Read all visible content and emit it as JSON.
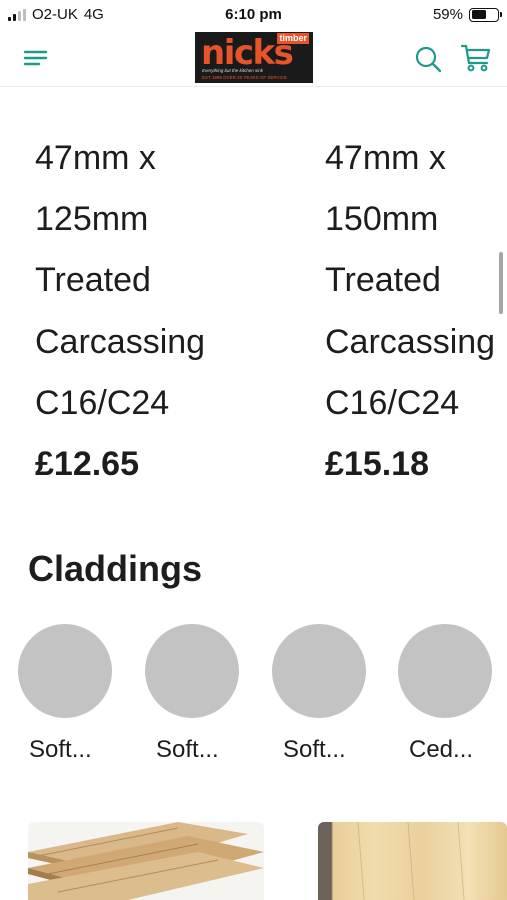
{
  "status_bar": {
    "carrier": "O2-UK",
    "network": "4G",
    "time": "6:10 pm",
    "battery_percent": "59%",
    "battery_level": 0.59
  },
  "header": {
    "logo_text": "nicks",
    "logo_sub": "timber",
    "logo_tagline": "Everything but the kitchen sink",
    "logo_est": "EST 1999 OVER 20 YEARS OF SERVICE",
    "icons": [
      "menu-icon",
      "search-icon",
      "cart-icon"
    ],
    "accent_color": "#1f9a8a",
    "logo_color": "#e8542a"
  },
  "products": [
    {
      "lines": [
        "47mm x",
        "125mm",
        "Treated",
        "Carcassing",
        "C16/C24"
      ],
      "price": "£12.65"
    },
    {
      "lines": [
        "47mm x",
        "150mm",
        "Treated",
        "Carcassing",
        "C16/C24"
      ],
      "price": "£15.18"
    }
  ],
  "claddings": {
    "title": "Claddings",
    "categories": [
      {
        "label": "Soft..."
      },
      {
        "label": "Soft..."
      },
      {
        "label": "Soft..."
      },
      {
        "label": "Ced..."
      }
    ]
  }
}
